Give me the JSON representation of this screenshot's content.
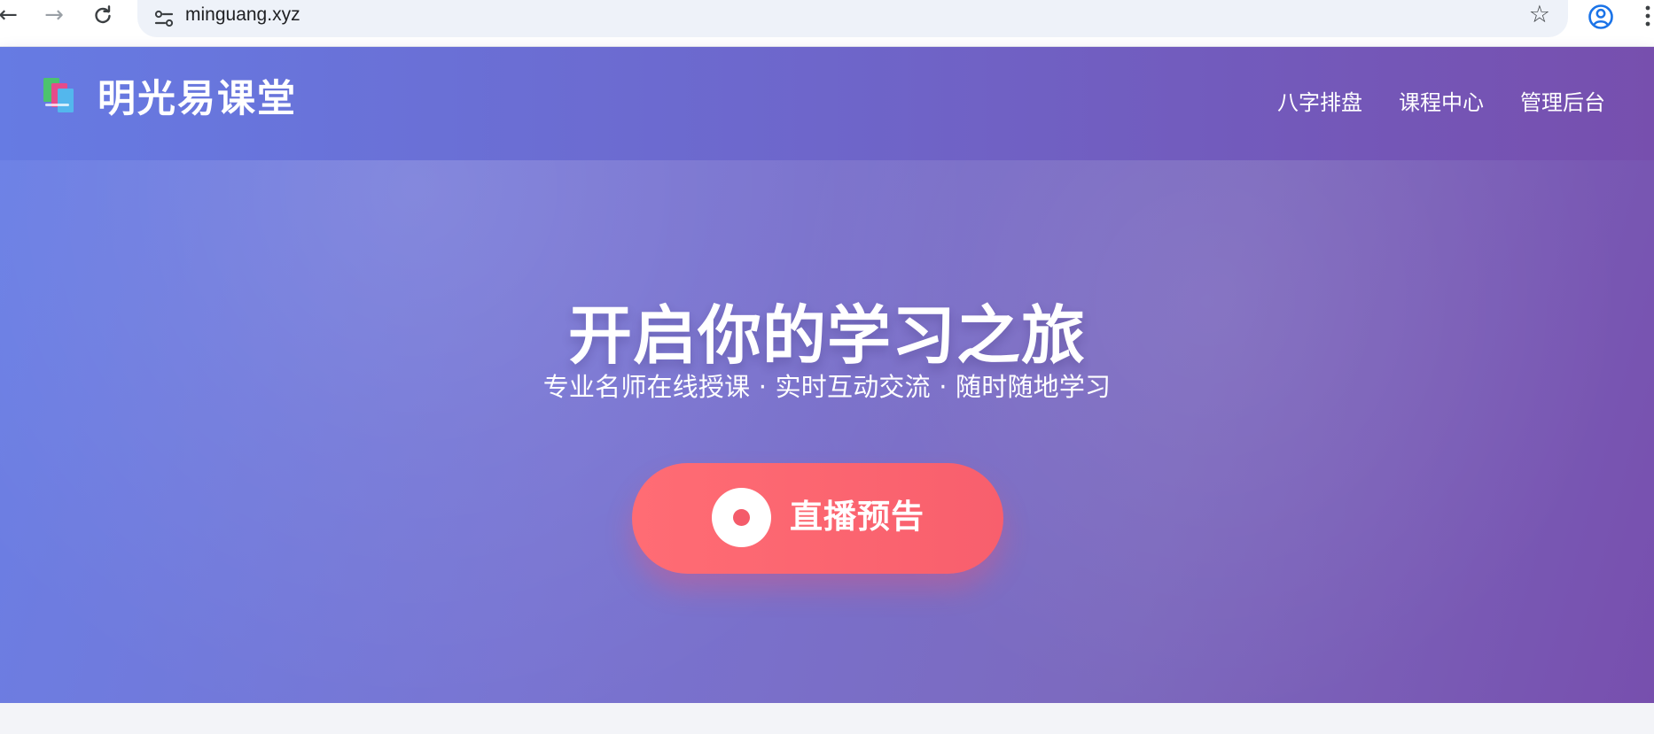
{
  "browser": {
    "back_icon": "arrow-left-icon",
    "forward_icon": "arrow-right-icon",
    "reload_icon": "reload-icon",
    "site_settings_icon": "tune-icon",
    "bookmark_icon": "star-icon",
    "profile_icon": "profile-icon",
    "menu_icon": "more-vertical-icon",
    "url": "minguang.xyz",
    "colors": {
      "toolbar": "#ffffff",
      "omnibox": "#eef2f9",
      "icon": "#3c4043",
      "profile": "#1a73e8"
    }
  },
  "header": {
    "logo_icon": "books-icon",
    "brand": "明光易课堂",
    "nav": [
      {
        "label": "八字排盘"
      },
      {
        "label": "课程中心"
      },
      {
        "label": "管理后台"
      }
    ],
    "colors": {
      "gradient_start": "#667be3",
      "gradient_end": "#774fae",
      "text": "#ffffff"
    }
  },
  "hero": {
    "title": "开启你的学习之旅",
    "subtitle": "专业名师在线授课 · 实时互动交流 · 随时随地学习",
    "cta": {
      "icon": "live-record-icon",
      "label": "直播预告",
      "color": "#ff6c74"
    },
    "colors": {
      "gradient_start": "#6a7fe5",
      "gradient_end": "#774fae"
    }
  }
}
